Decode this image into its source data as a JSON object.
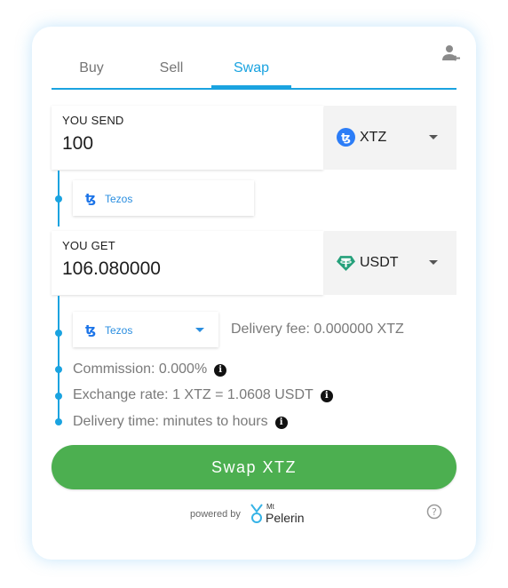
{
  "tabs": [
    {
      "label": "Buy",
      "active": false
    },
    {
      "label": "Sell",
      "active": false
    },
    {
      "label": "Swap",
      "active": true
    }
  ],
  "send": {
    "label": "YOU SEND",
    "value": "100",
    "currency": "XTZ",
    "currency_icon": "tezos-icon",
    "currency_color": "#2c7df7"
  },
  "send_network": {
    "label": "Tezos",
    "icon": "tezos-network-icon"
  },
  "get": {
    "label": "YOU GET",
    "value": "106.080000",
    "currency": "USDT",
    "currency_icon": "tether-icon",
    "currency_color": "#26a17b"
  },
  "get_network": {
    "label": "Tezos",
    "icon": "tezos-network-icon",
    "dropdown": true
  },
  "delivery_fee": "Delivery fee: 0.000000 XTZ",
  "commission": "Commission: 0.000%",
  "exchange_rate": "Exchange rate: 1 XTZ = 1.0608 USDT",
  "delivery_time": "Delivery time: minutes to hours",
  "swap_button": "Swap XTZ",
  "footer": {
    "powered_by": "powered by",
    "brand_small": "Mt",
    "brand": "Pelerin"
  },
  "colors": {
    "accent": "#1aa3e0",
    "button": "#4caf50"
  }
}
